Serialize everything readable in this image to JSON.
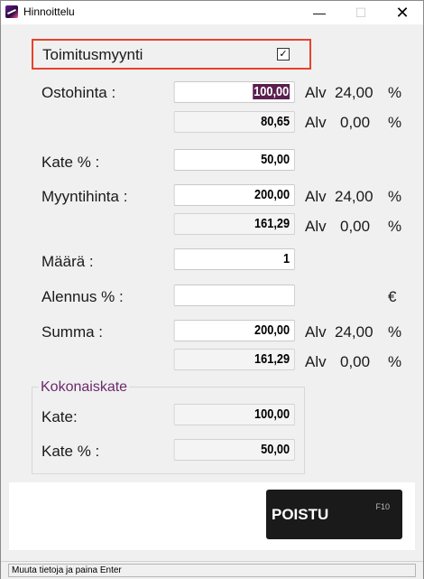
{
  "window": {
    "title": "Hinnoittelu",
    "min_glyph": "—",
    "max_glyph": "☐",
    "close_glyph": "✕"
  },
  "toimitusmyynti": {
    "label": "Toimitusmyynti",
    "checked_glyph": "✓"
  },
  "rows": {
    "ostohinta": {
      "label": "Ostohinta :",
      "value": "100,00",
      "value2": "80,65",
      "alv_label": "Alv",
      "alv_rate": "24,00",
      "alv_rate2": "0,00",
      "pct": "%"
    },
    "kate": {
      "label": "Kate % :",
      "value": "50,00"
    },
    "myyntihinta": {
      "label": "Myyntihinta :",
      "value": "200,00",
      "value2": "161,29",
      "alv_label": "Alv",
      "alv_rate": "24,00",
      "alv_rate2": "0,00",
      "pct": "%"
    },
    "maara": {
      "label": "Määrä :",
      "value": "1"
    },
    "alennus": {
      "label": "Alennus % :",
      "value": "",
      "currency": "€"
    },
    "summa": {
      "label": "Summa :",
      "value": "200,00",
      "value2": "161,29",
      "alv_label": "Alv",
      "alv_rate": "24,00",
      "alv_rate2": "0,00",
      "pct": "%"
    }
  },
  "kokonaiskate": {
    "title": "Kokonaiskate",
    "kate_label": "Kate:",
    "kate_value": "100,00",
    "kate_pct_label": "Kate % :",
    "kate_pct_value": "50,00"
  },
  "poistu": {
    "label": "POISTU",
    "key": "F10"
  },
  "status": {
    "text": "Muuta tietoja ja paina Enter"
  }
}
